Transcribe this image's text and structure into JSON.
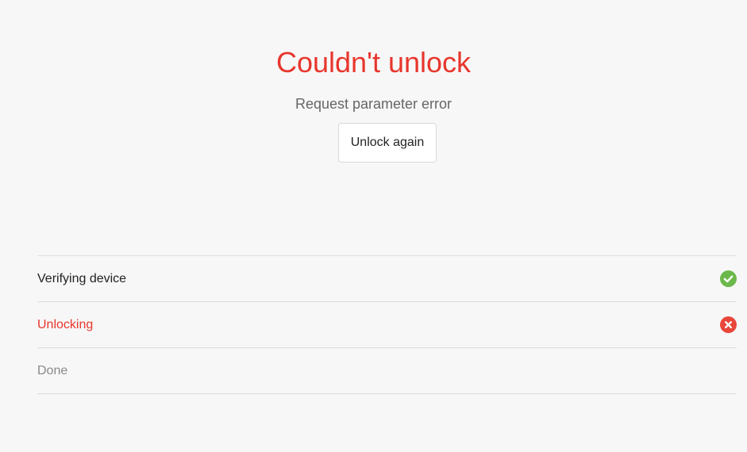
{
  "result": {
    "title": "Couldn't unlock",
    "message": "Request parameter error",
    "retry_label": "Unlock again"
  },
  "steps": [
    {
      "label": "Verifying device",
      "status": "success",
      "icon": "check-circle-icon"
    },
    {
      "label": "Unlocking",
      "status": "error",
      "icon": "x-circle-icon"
    },
    {
      "label": "Done",
      "status": "pending",
      "icon": ""
    }
  ],
  "colors": {
    "error": "#e8362d",
    "success": "#6bb84a",
    "background": "#f7f7f7",
    "divider": "#dedede"
  }
}
